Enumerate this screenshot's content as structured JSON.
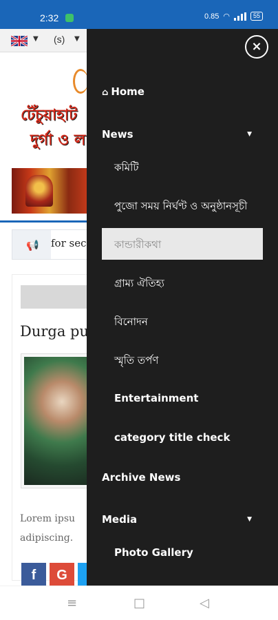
{
  "status_bar": {
    "time": "2:32",
    "network_speed": "0.85",
    "battery": "55"
  },
  "page": {
    "language_label": "(s)",
    "headline_line1": "টেঁচুয়াহাট",
    "headline_line2": "দুর্গা ও ল",
    "ticker_text": "for sec",
    "card_title": "Durga pu",
    "lorem_line1": "Lorem ipsu",
    "lorem_line2": "adipiscing.",
    "share": {
      "facebook": "f",
      "google": "G"
    }
  },
  "drawer": {
    "close_label": "×",
    "items": [
      {
        "label": "Home",
        "level": "top",
        "icon": "home-icon"
      },
      {
        "label": "News",
        "level": "top",
        "expandable": true
      },
      {
        "label": "কমিটি",
        "level": "sub"
      },
      {
        "label": "পুজো সময় নির্ঘণ্ট ও অনুষ্ঠানসূচী",
        "level": "sub"
      },
      {
        "label": "কান্ডারীকথা",
        "level": "sub",
        "active": true
      },
      {
        "label": "গ্রাম্য ঐতিহ্য",
        "level": "sub"
      },
      {
        "label": "বিনোদন",
        "level": "sub"
      },
      {
        "label": "স্মৃতি তর্পণ",
        "level": "sub"
      },
      {
        "label": "Entertainment",
        "level": "sub"
      },
      {
        "label": "category title check",
        "level": "sub"
      },
      {
        "label": "Archive News",
        "level": "top"
      },
      {
        "label": "Media",
        "level": "top",
        "expandable": true
      },
      {
        "label": "Photo Gallery",
        "level": "sub"
      }
    ]
  },
  "colors": {
    "status_bar": "#1a66b8",
    "drawer_bg": "#1e1e1e",
    "active_item_bg": "#e8e8e8",
    "headline": "#d42a1b"
  },
  "nav_bar": {
    "menu": "≡",
    "home": "□",
    "back": "◁"
  }
}
